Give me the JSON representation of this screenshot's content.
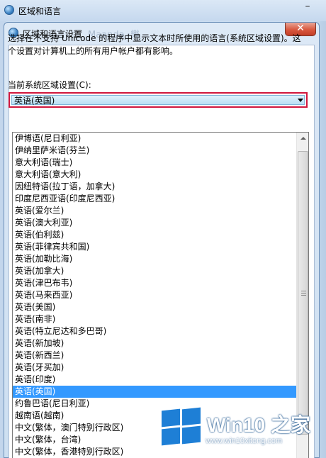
{
  "outer_window": {
    "title": "区域和语言",
    "minimize_glyph": "–"
  },
  "dialog": {
    "title": "区域和语言设置",
    "blurred_text": "Maanda  ·樂",
    "close_glyph": "✕",
    "description": "选择在不支持 Unicode 的程序中显示文本时所使用的语言(系统区域设置)。这个设置对计算机上的所有用户帐户都有影响。",
    "locale_label": "当前系统区域设置(C):",
    "current_value": "英语(英国)"
  },
  "dropdown": {
    "items": [
      "伊博语(尼日利亚)",
      "伊纳里萨米语(芬兰)",
      "意大利语(瑞士)",
      "意大利语(意大利)",
      "因纽特语(拉丁语，加拿大)",
      "印度尼西亚语(印度尼西亚)",
      "英语(爱尔兰)",
      "英语(澳大利亚)",
      "英语(伯利兹)",
      "英语(菲律宾共和国)",
      "英语(加勒比海)",
      "英语(加拿大)",
      "英语(津巴布韦)",
      "英语(马来西亚)",
      "英语(美国)",
      "英语(南非)",
      "英语(特立尼达和多巴哥)",
      "英语(新加坡)",
      "英语(新西兰)",
      "英语(牙买加)",
      "英语(印度)",
      "英语(英国)",
      "约鲁巴语(尼日利亚)",
      "越南语(越南)",
      "中文(繁体，澳门特别行政区)",
      "中文(繁体，台湾)",
      "中文(繁体，香港特别行政区)"
    ],
    "selected_index": 21
  },
  "watermark": {
    "brand": "Win10 之家",
    "url": "www.win10xitong.com"
  },
  "colors": {
    "selection": "#3399ff",
    "combo_border": "#d0173d",
    "logo_blue": "#1e7fd6"
  }
}
